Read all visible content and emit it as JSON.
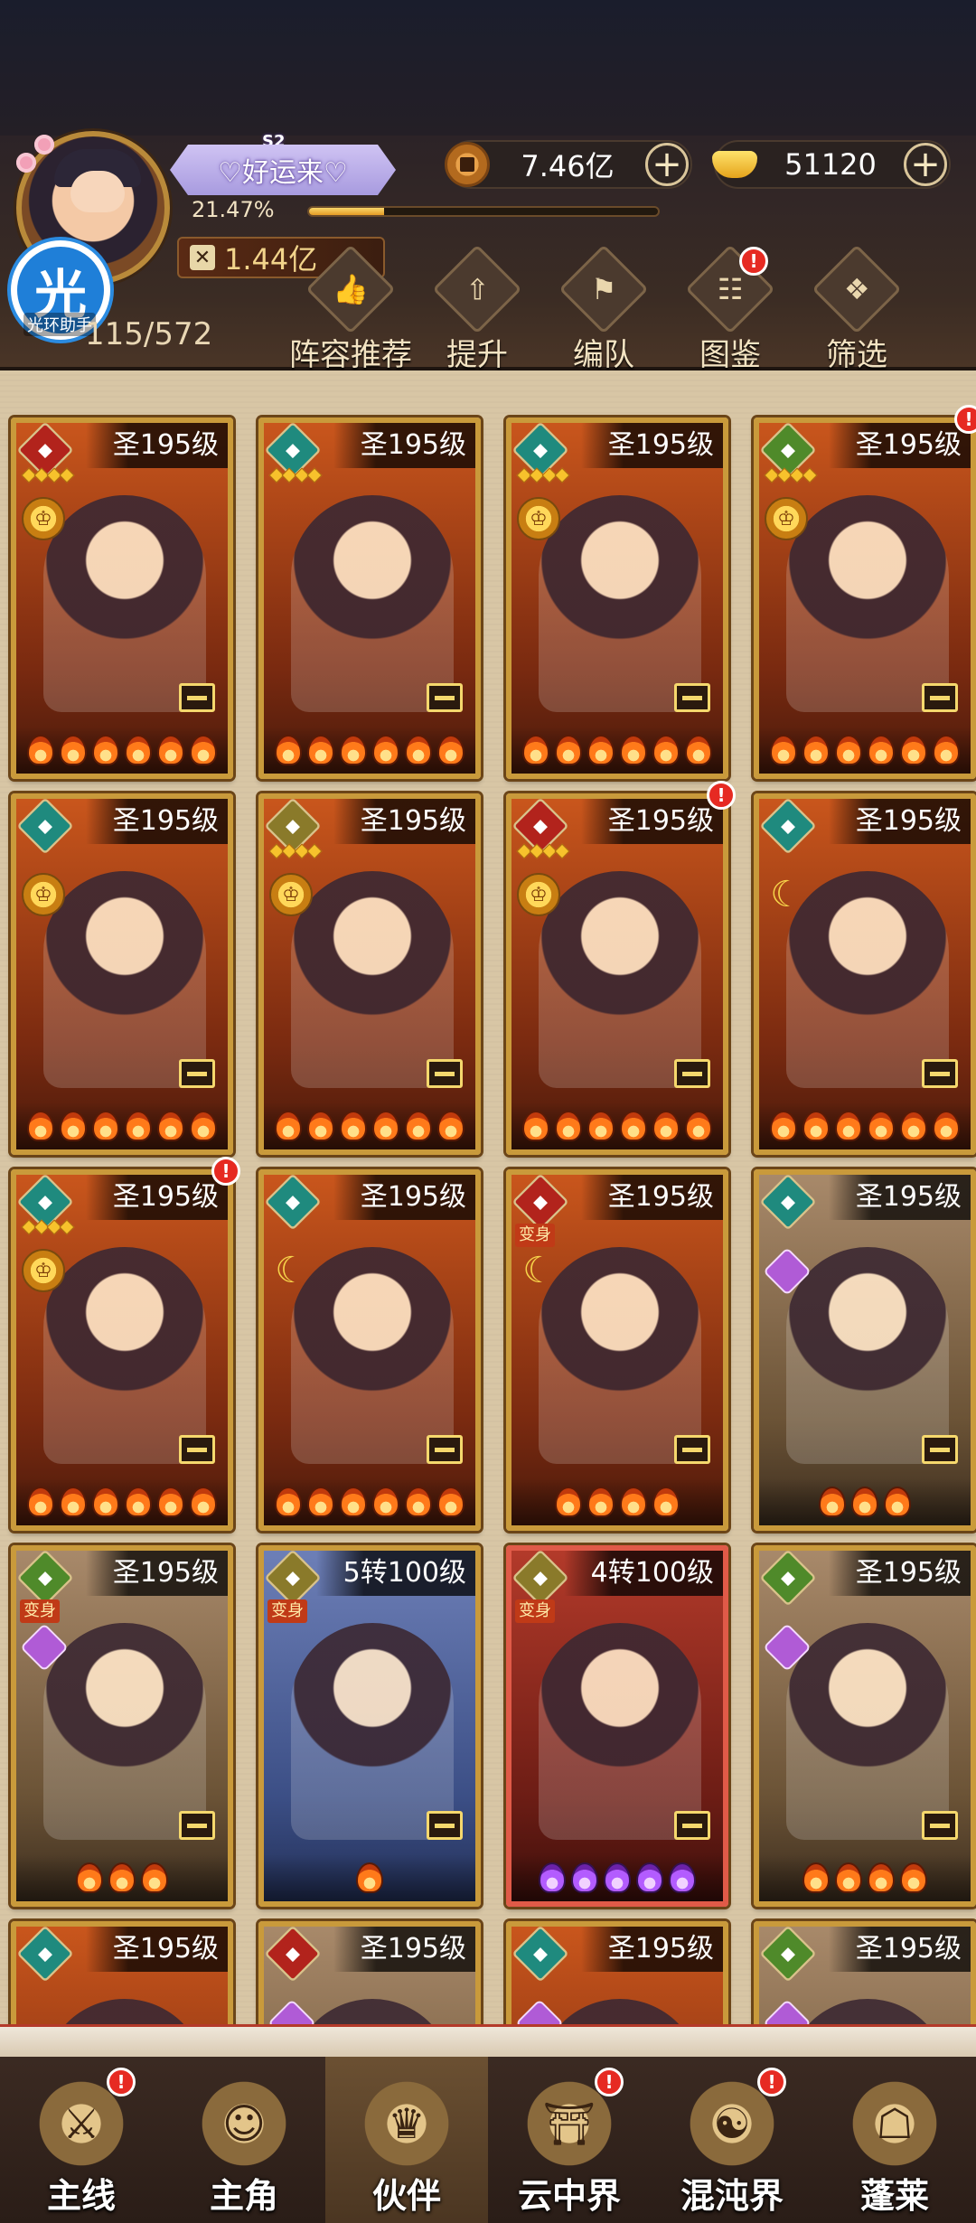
{
  "player": {
    "name": "♡好运来♡",
    "season": "S2",
    "exp_percent": "21.47%",
    "exp_fraction": 0.2147,
    "power": "1.44亿"
  },
  "helper": {
    "glyph": "光",
    "label": "光环助手"
  },
  "resources": {
    "copper": "7.46亿",
    "gold": "51120"
  },
  "partners": {
    "label": "伙伴",
    "count": "115/572"
  },
  "menu": [
    {
      "label": "阵容推荐",
      "icon": "thumbs-up-icon",
      "glyph": "👍",
      "alert": false
    },
    {
      "label": "提升",
      "icon": "arrow-up-icon",
      "glyph": "⇧",
      "alert": false
    },
    {
      "label": "编队",
      "icon": "flag-icon",
      "glyph": "⚑",
      "alert": false
    },
    {
      "label": "图鉴",
      "icon": "scroll-icon",
      "glyph": "☷",
      "alert": true
    },
    {
      "label": "筛选",
      "icon": "filter-icon",
      "glyph": "❖",
      "alert": false
    }
  ],
  "cards": [
    {
      "level": "圣195级",
      "bg": "orange",
      "element": "red",
      "stars": 4,
      "rank": "crown",
      "flames": 6,
      "alert": false,
      "transform": false
    },
    {
      "level": "圣195级",
      "bg": "orange",
      "element": "teal",
      "stars": 4,
      "rank": "none",
      "flames": 6,
      "alert": false,
      "transform": false
    },
    {
      "level": "圣195级",
      "bg": "orange",
      "element": "teal",
      "stars": 4,
      "rank": "crown",
      "flames": 6,
      "alert": false,
      "transform": false
    },
    {
      "level": "圣195级",
      "bg": "orange",
      "element": "green",
      "stars": 4,
      "rank": "crown",
      "flames": 6,
      "alert": true,
      "transform": false
    },
    {
      "level": "圣195级",
      "bg": "orange",
      "element": "teal",
      "stars": 0,
      "rank": "crown",
      "flames": 6,
      "alert": false,
      "transform": false
    },
    {
      "level": "圣195级",
      "bg": "orange",
      "element": "gold",
      "stars": 4,
      "rank": "crown",
      "flames": 6,
      "alert": false,
      "transform": false
    },
    {
      "level": "圣195级",
      "bg": "orange",
      "element": "red",
      "stars": 4,
      "rank": "crown",
      "flames": 6,
      "alert": true,
      "transform": false
    },
    {
      "level": "圣195级",
      "bg": "orange",
      "element": "teal",
      "stars": 0,
      "rank": "moon",
      "flames": 6,
      "alert": false,
      "transform": false
    },
    {
      "level": "圣195级",
      "bg": "orange",
      "element": "teal",
      "stars": 4,
      "rank": "crown",
      "flames": 6,
      "alert": true,
      "transform": false
    },
    {
      "level": "圣195级",
      "bg": "orange",
      "element": "teal",
      "stars": 0,
      "rank": "moon",
      "flames": 6,
      "alert": false,
      "transform": false
    },
    {
      "level": "圣195级",
      "bg": "orange",
      "element": "red",
      "stars": 0,
      "rank": "moon",
      "flames": 4,
      "alert": false,
      "transform": true
    },
    {
      "level": "圣195级",
      "bg": "gold",
      "element": "teal",
      "stars": 0,
      "rank": "diamond",
      "flames": 3,
      "alert": false,
      "transform": false
    },
    {
      "level": "圣195级",
      "bg": "gold",
      "element": "green",
      "stars": 0,
      "rank": "diamond",
      "flames": 3,
      "alert": false,
      "transform": true
    },
    {
      "level": "5转100级",
      "bg": "blue",
      "element": "gold",
      "stars": 0,
      "rank": "none",
      "flames": 1,
      "alert": false,
      "transform": true
    },
    {
      "level": "4转100级",
      "bg": "red",
      "element": "gold",
      "stars": 0,
      "rank": "none",
      "flames": 5,
      "alert": false,
      "transform": true,
      "flame_color": "purple"
    },
    {
      "level": "圣195级",
      "bg": "gold",
      "element": "green",
      "stars": 0,
      "rank": "diamond",
      "flames": 4,
      "alert": false,
      "transform": false
    },
    {
      "level": "圣195级",
      "bg": "orange",
      "element": "teal",
      "stars": 0,
      "rank": "none",
      "flames": 0,
      "alert": false,
      "transform": false
    },
    {
      "level": "圣195级",
      "bg": "gold",
      "element": "red",
      "stars": 0,
      "rank": "diamond",
      "flames": 0,
      "alert": false,
      "transform": false
    },
    {
      "level": "圣195级",
      "bg": "orange",
      "element": "teal",
      "stars": 0,
      "rank": "diamond",
      "flames": 0,
      "alert": false,
      "transform": false
    },
    {
      "level": "圣195级",
      "bg": "gold",
      "element": "green",
      "stars": 0,
      "rank": "diamond",
      "flames": 0,
      "alert": false,
      "transform": false
    }
  ],
  "transform_label": "变身",
  "nav": [
    {
      "label": "主线",
      "icon": "crossed-swords-icon",
      "glyph": "⚔",
      "alert": true,
      "active": false
    },
    {
      "label": "主角",
      "icon": "hero-icon",
      "glyph": "☺",
      "alert": false,
      "active": false
    },
    {
      "label": "伙伴",
      "icon": "partner-icon",
      "glyph": "♛",
      "alert": false,
      "active": true
    },
    {
      "label": "云中界",
      "icon": "pavilion-icon",
      "glyph": "⛩",
      "alert": true,
      "active": false
    },
    {
      "label": "混沌界",
      "icon": "chaos-icon",
      "glyph": "☯",
      "alert": true,
      "active": false
    },
    {
      "label": "蓬莱",
      "icon": "immortal-icon",
      "glyph": "☖",
      "alert": false,
      "active": false
    }
  ],
  "colors": {
    "accent_gold": "#c99a3b",
    "alert_red": "#e62a22",
    "name_plate": "#a89bdf"
  }
}
